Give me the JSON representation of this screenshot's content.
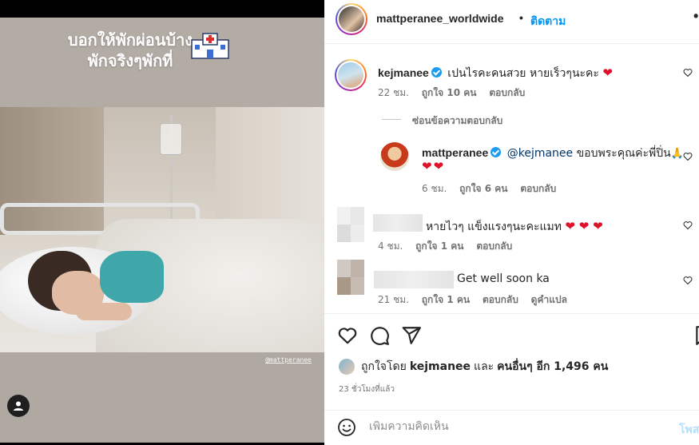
{
  "media": {
    "caption_line1": "บอกให้พักผ่อนบ้าง",
    "caption_line2": "พักจริงๆพักที่",
    "watermark": "@mattperanee"
  },
  "header": {
    "username": "mattperanee_worldwide",
    "dot": "•",
    "follow_label": "ติดตาม",
    "more_icon": "•"
  },
  "comments": [
    {
      "username": "kejmanee",
      "verified": true,
      "text": "เปนไรคะคนสวย หายเร็วๆนะคะ",
      "emoji": "❤",
      "time": "22 ชม.",
      "likes": "ถูกใจ 10 คน",
      "reply": "ตอบกลับ"
    },
    {
      "hide_replies": "ซ่อนข้อความตอบกลับ"
    },
    {
      "username": "mattperanee",
      "verified": true,
      "mention": "@kejmanee",
      "text": "ขอบพระคุณค่ะพี่ปิ่น",
      "emoji_pray": "🙏",
      "emoji_line2": "❤❤",
      "time": "6 ชม.",
      "likes": "ถูกใจ 6 คน",
      "reply": "ตอบกลับ"
    },
    {
      "text": "หายไวๆ แข็งแรงๆนะคะแมท",
      "emoji": "❤ ❤ ❤",
      "time": "4 ชม.",
      "likes": "ถูกใจ 1 คน",
      "reply": "ตอบกลับ"
    },
    {
      "text": "Get well soon ka",
      "time": "21 ชม.",
      "likes": "ถูกใจ 1 คน",
      "reply": "ตอบกลับ",
      "translate": "ดูคำแปล"
    }
  ],
  "likes": {
    "prefix": "ถูกใจโดย",
    "user": "kejmanee",
    "and": "และ",
    "others": "คนอื่นๆ อีก 1,496 คน"
  },
  "time_ago": "23 ชั่วโมงที่แล้ว",
  "add_comment": {
    "placeholder": "เพิ่มความคิดเห็น",
    "post_label": "โพสต์"
  },
  "colors": {
    "accent": "#0095f6",
    "heart": "#e0112b",
    "verified": "#1d9bf0"
  }
}
